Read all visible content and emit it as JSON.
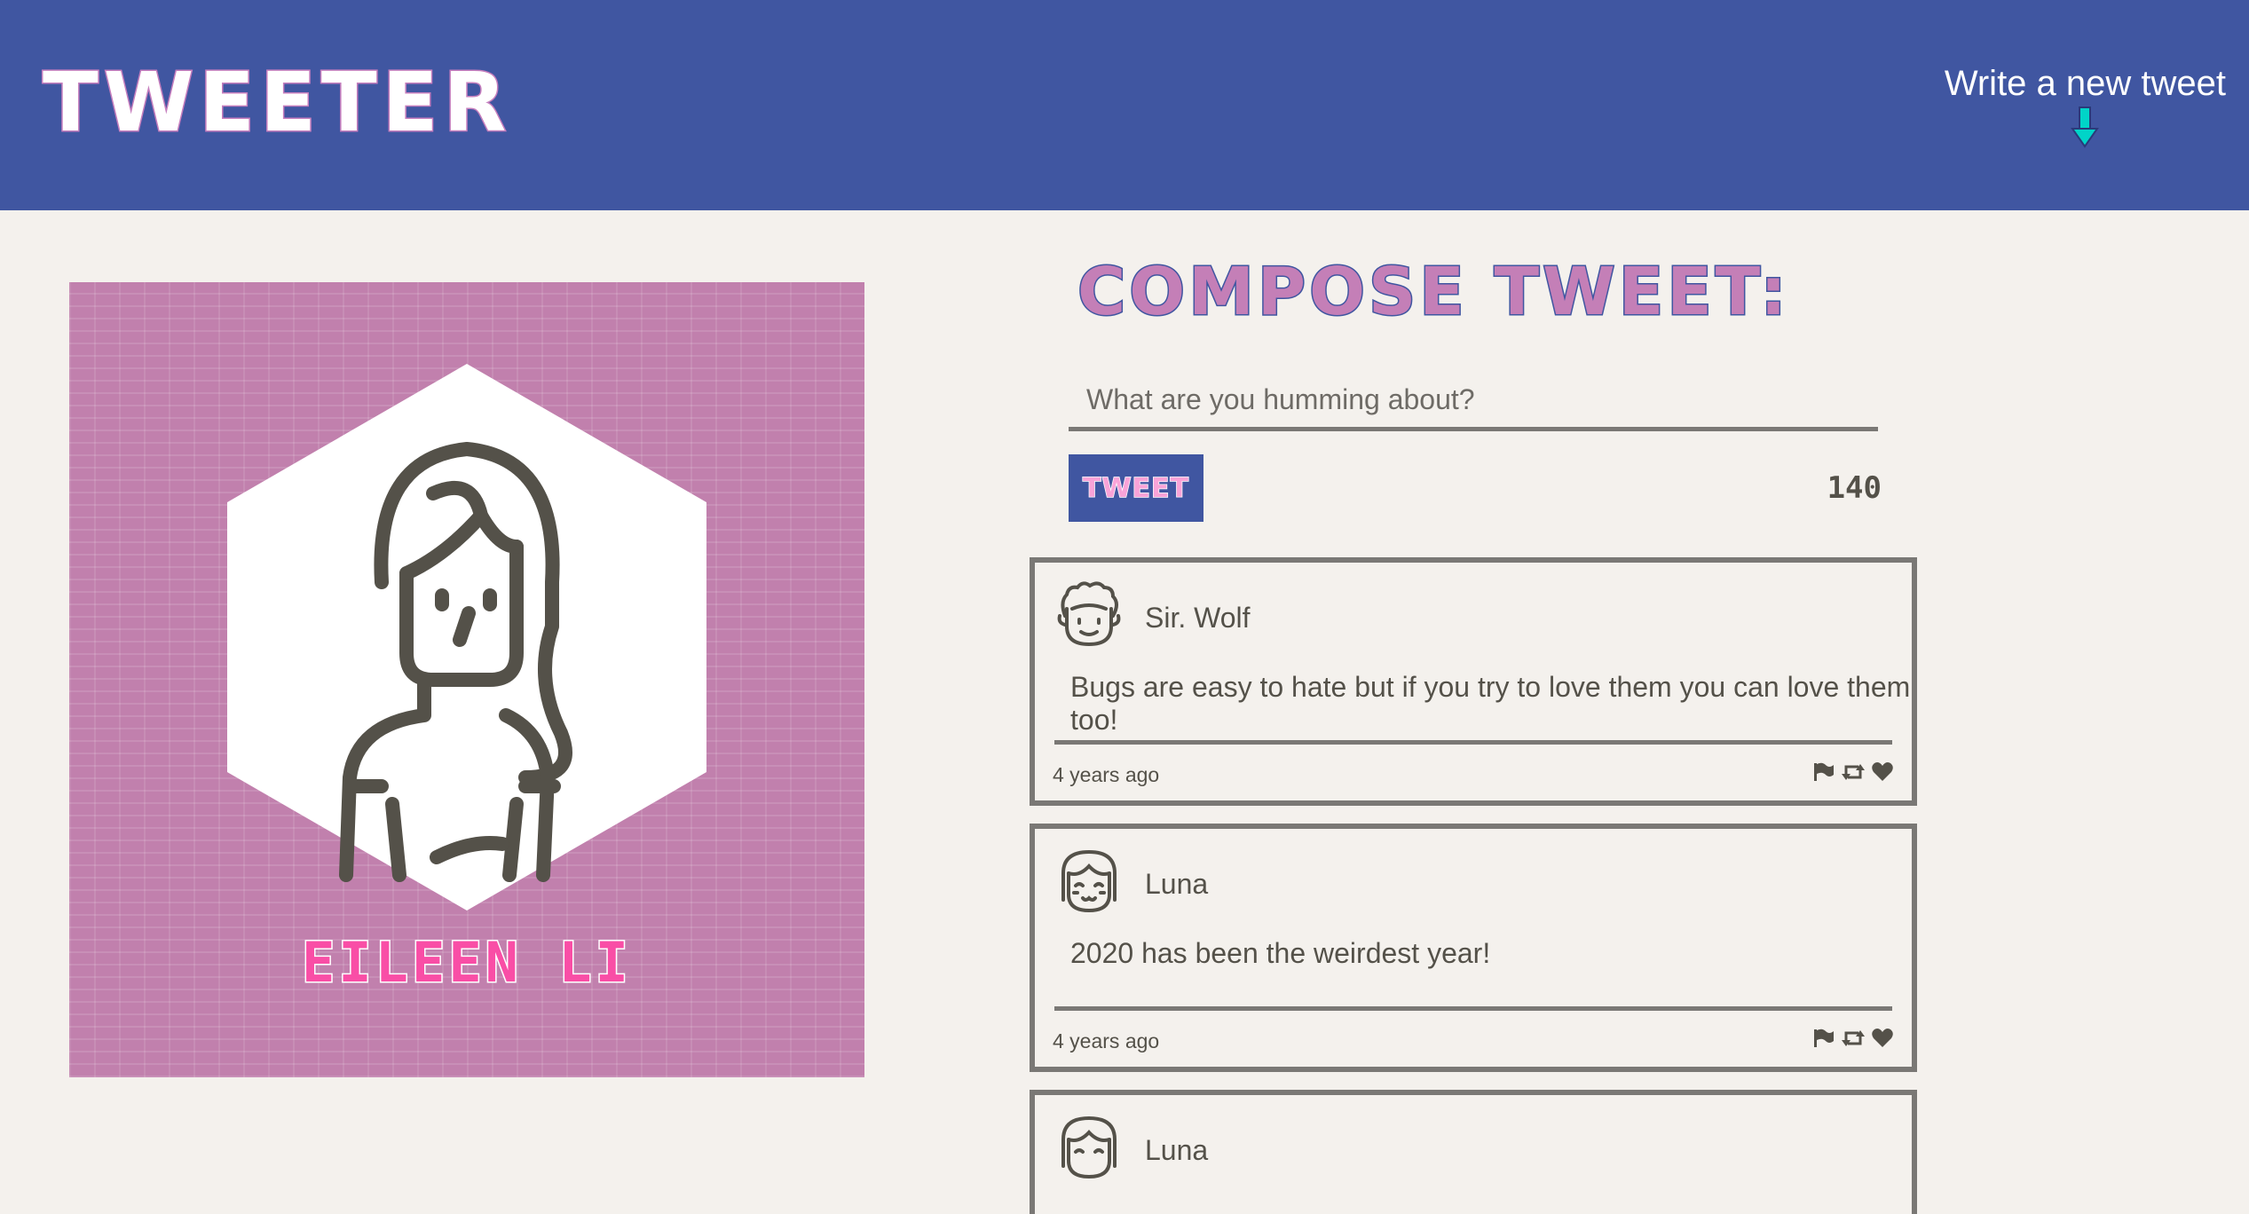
{
  "header": {
    "brand": "TWEETER",
    "write_tweet_label": "Write a new tweet",
    "write_tweet_icon": "arrow-down-icon",
    "accent_color": "#4056a1",
    "arrow_color": "#00d4c8"
  },
  "profile": {
    "name": "EILEEN LI",
    "avatar_icon": "girl-avatar-icon",
    "background_color": "#c180ad",
    "name_color": "#f94ea6"
  },
  "compose": {
    "title": "COMPOSE TWEET:",
    "placeholder": "What are you humming about?",
    "value": "",
    "button_label": "TWEET",
    "char_count": "140"
  },
  "tweets": [
    {
      "user": "Sir. Wolf",
      "avatar_icon": "curly-hair-avatar-icon",
      "text": "Bugs are easy to hate but if you try to love them you can love them too!",
      "time": "4 years ago",
      "actions": [
        "flag-icon",
        "retweet-icon",
        "heart-icon"
      ]
    },
    {
      "user": "Luna",
      "avatar_icon": "bangs-avatar-icon",
      "text": "2020 has been the weirdest year!",
      "time": "4 years ago",
      "actions": [
        "flag-icon",
        "retweet-icon",
        "heart-icon"
      ]
    },
    {
      "user": "Luna",
      "avatar_icon": "bangs-avatar-icon"
    }
  ]
}
